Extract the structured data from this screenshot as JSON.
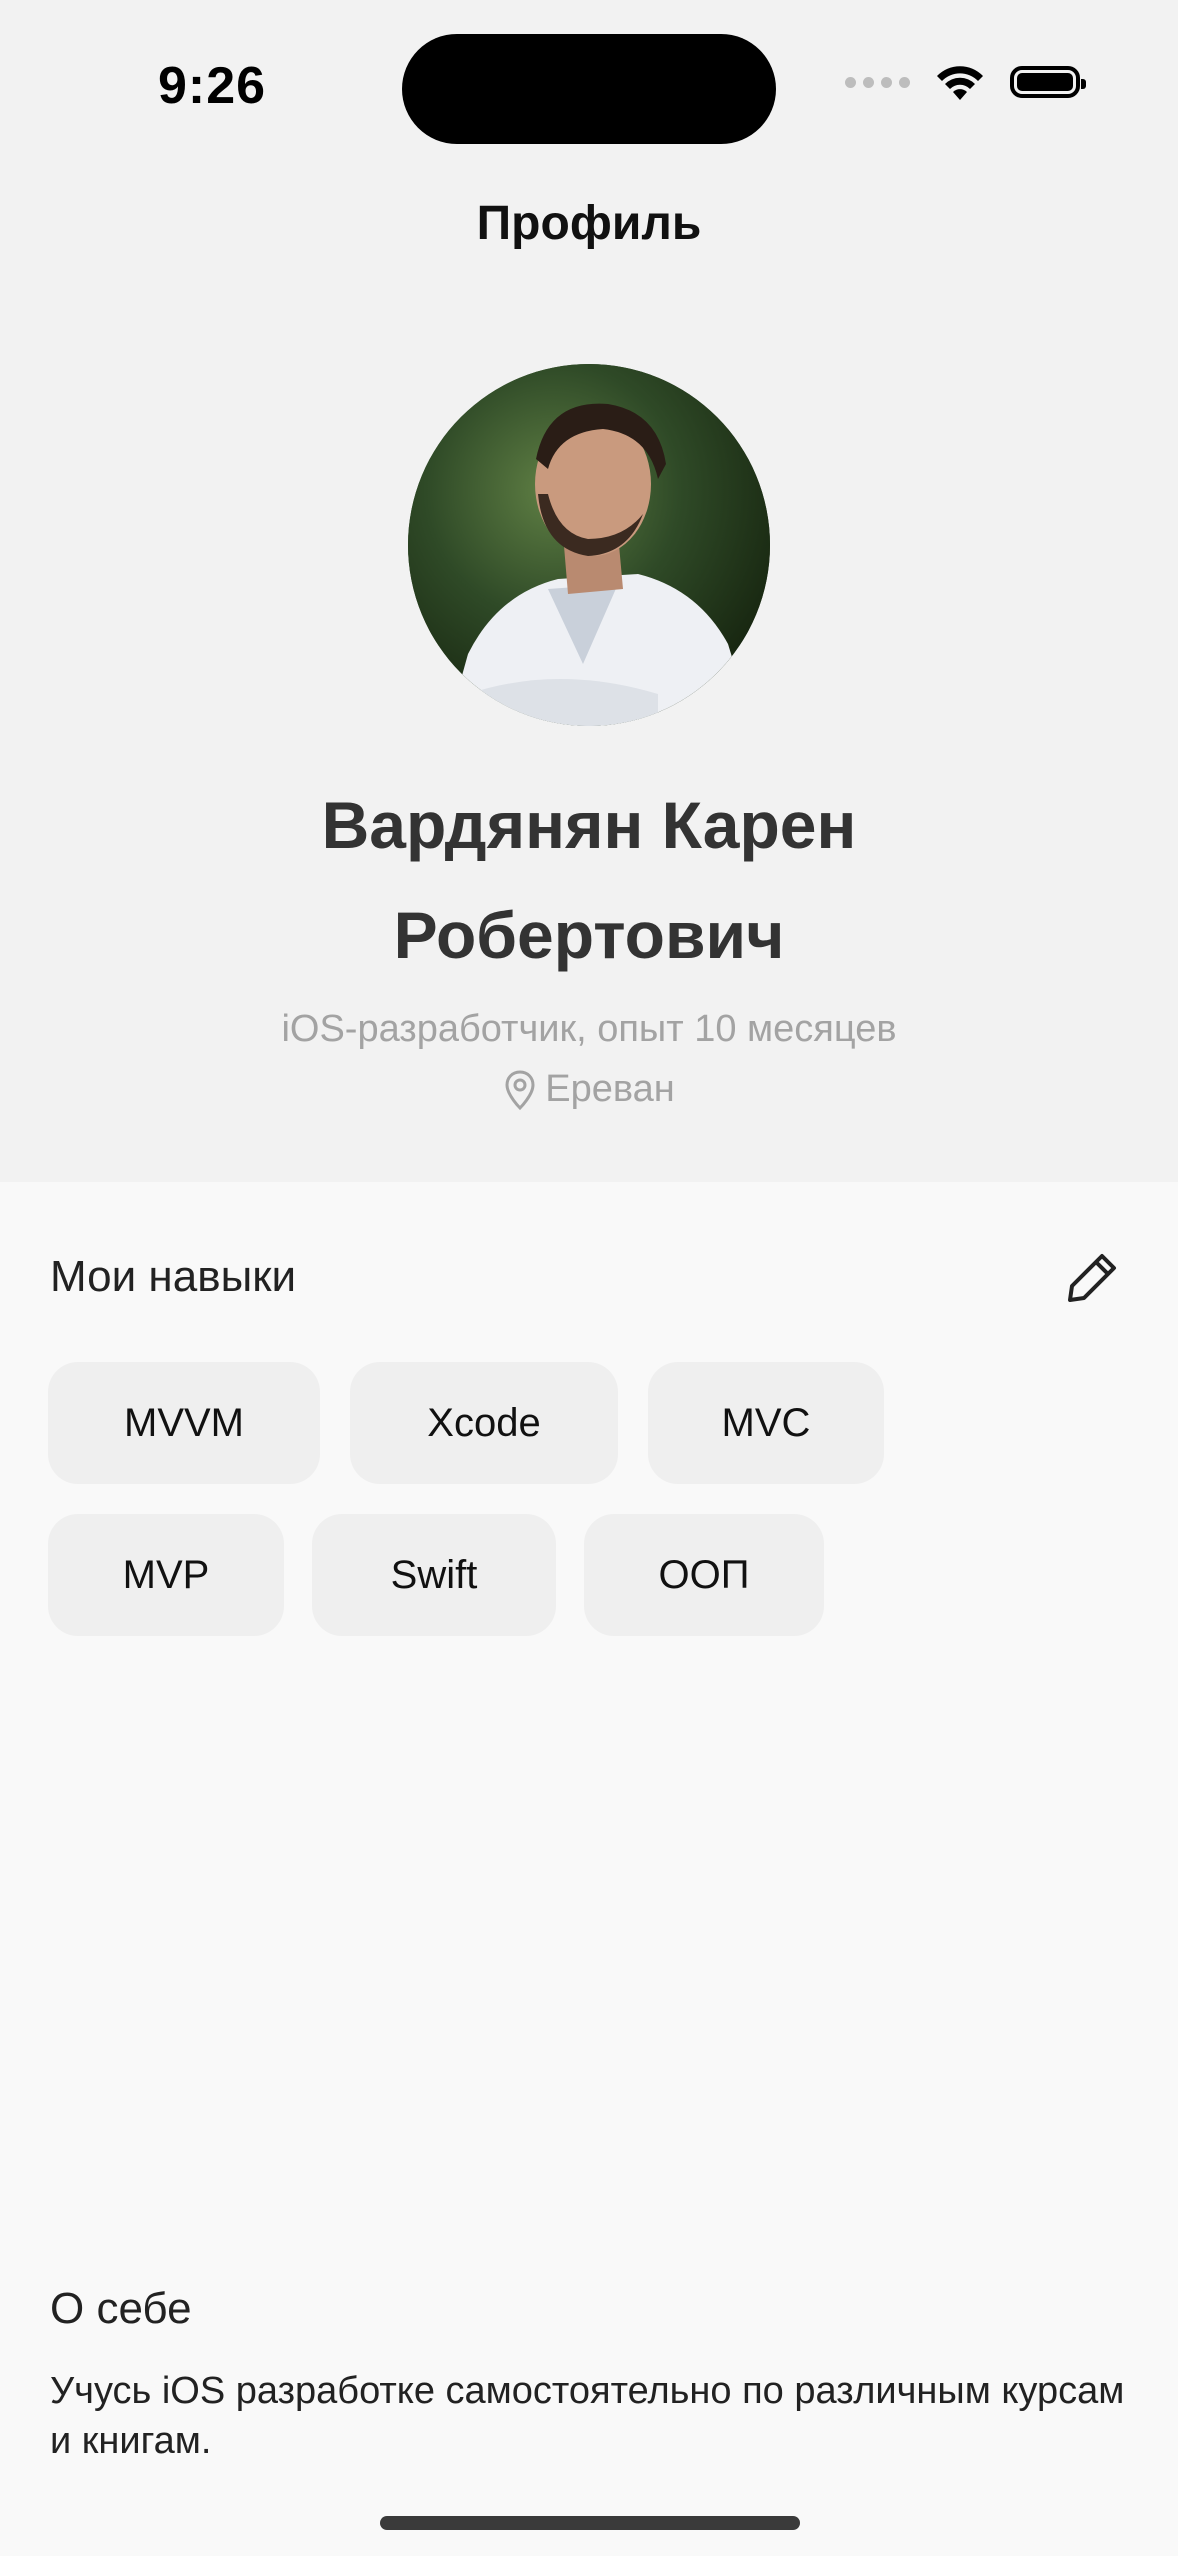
{
  "status_bar": {
    "time": "9:26"
  },
  "nav": {
    "title": "Профиль"
  },
  "profile": {
    "name_line1": "Вардянян Карен",
    "name_line2": "Робертович",
    "subtitle": "iOS-разработчик, опыт 10 месяцев",
    "location": "Ереван"
  },
  "skills": {
    "title": "Мои навыки",
    "items": [
      "MVVM",
      "Xcode",
      "MVC",
      "MVP",
      "Swift",
      "ООП"
    ]
  },
  "about": {
    "title": "О себе",
    "text": "Учусь iOS разработке самостоятельно по различным курсам и книгам."
  },
  "colors": {
    "header_background": "#f2f2f2",
    "page_background": "#f9f9f9",
    "chip_background": "#efefef",
    "secondary_text": "#a3a3a3"
  }
}
